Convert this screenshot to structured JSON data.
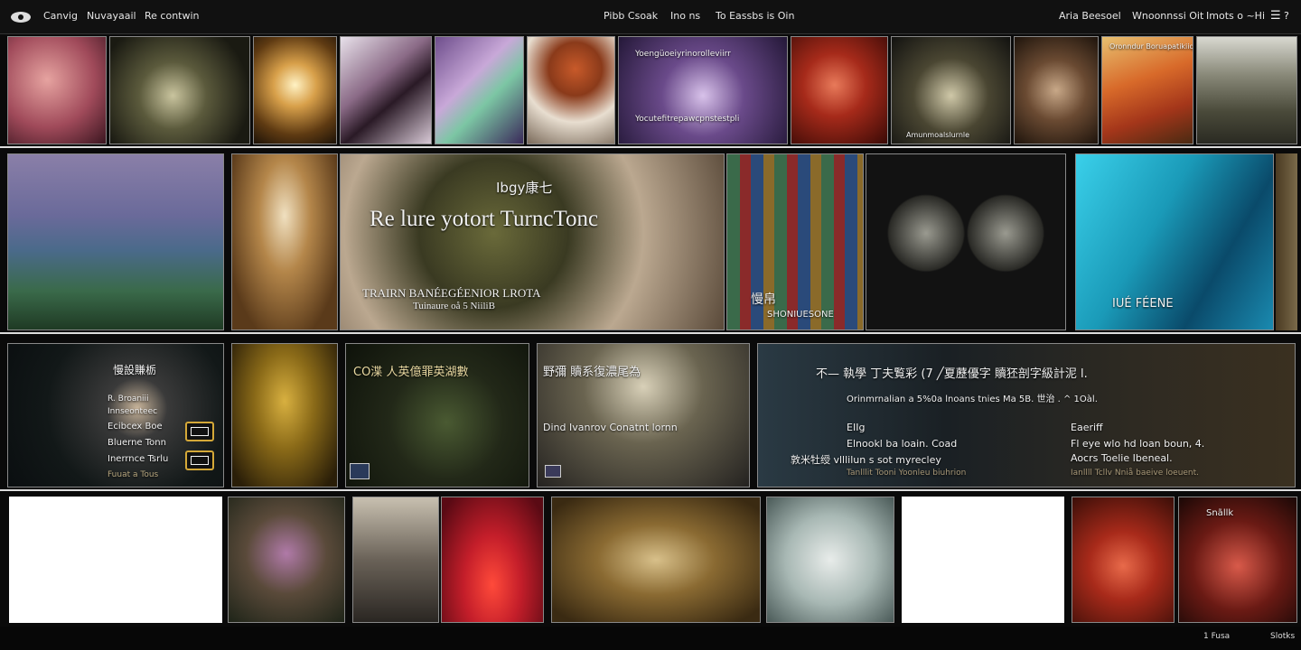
{
  "topbar": {
    "left_links": [
      "Canvig",
      "Nuvayaail",
      "Re contwin"
    ],
    "center_links": [
      "Pibb Csoak",
      "Ino ns",
      "To Eassbs is Oin"
    ],
    "right_links": [
      "Aria Beesoel",
      "Wnoonnssi Oit",
      "Imots o ~Hi"
    ]
  },
  "hero": {
    "tag": "Ibgy康七",
    "title": "Re lure yotort TurncTonc",
    "subtitle": "TRAIRN BANÉEGÉENIOR LROTA",
    "subline": "Tuinaure oå 5 NiiliB"
  },
  "captions": {
    "books_a": "慢帛",
    "books_b": "SHONIUESONE",
    "cyan": "IUÉ FÉENE",
    "purple_top": "Yoengüoeiyrinorolleviirr",
    "purple_bottom": "Yocutefitrepawcpnstestpli",
    "dark_city": "Amunmoalslurnle",
    "crimson": "Oronndur Boruapatikiiqu",
    "last": "Snãllk"
  },
  "cards": {
    "night": {
      "title": "慢設賺栃",
      "lines": [
        "R. Broaniii",
        "Innseonteec",
        "Ecibcex Boe",
        "Bluerne Tonn",
        "Inerrnce Tsrlu",
        "Fuuat a Tous"
      ]
    },
    "spiral": {
      "title": "CO渫 人英億罪英湖數"
    },
    "vinyl": {
      "title": "野彌 贖系復濃尾為",
      "sub": "Dind Ivanrov Conatnt lornn"
    },
    "wide": {
      "title": "不— 執學 丁夫覧彩 (7 ╱夏藶優字 贖狉剖字級計泥 l.",
      "desc": "Orinmrnalian a 5%0a lnoans tnies Ma 5B.   世治 . ^ 1Oàl.",
      "left_head": "EIIg",
      "left_lines": [
        "Elnookl ba loain. Coad",
        "敦米牡绶  vlllilun s sot myrecley",
        "Tanlllit Tooni Yoonleu biuhrion"
      ],
      "right_head": "Eaeriff",
      "right_lines": [
        "Fl eye wlo hd loan boun, 4.",
        "Aocrs Toelie Ibeneal.",
        "Ianllll Tcllv Nniå baeive loeuent."
      ]
    }
  },
  "bottombar": {
    "left": "1 Fusa",
    "right": "Slotks"
  },
  "colors": {
    "background": "#0a0a0a",
    "accent": "#d4a838",
    "divider": "#dddddd"
  },
  "icons": [
    "logo-icon",
    "search-icon",
    "menu-icon",
    "user-icon",
    "qr-icon"
  ]
}
